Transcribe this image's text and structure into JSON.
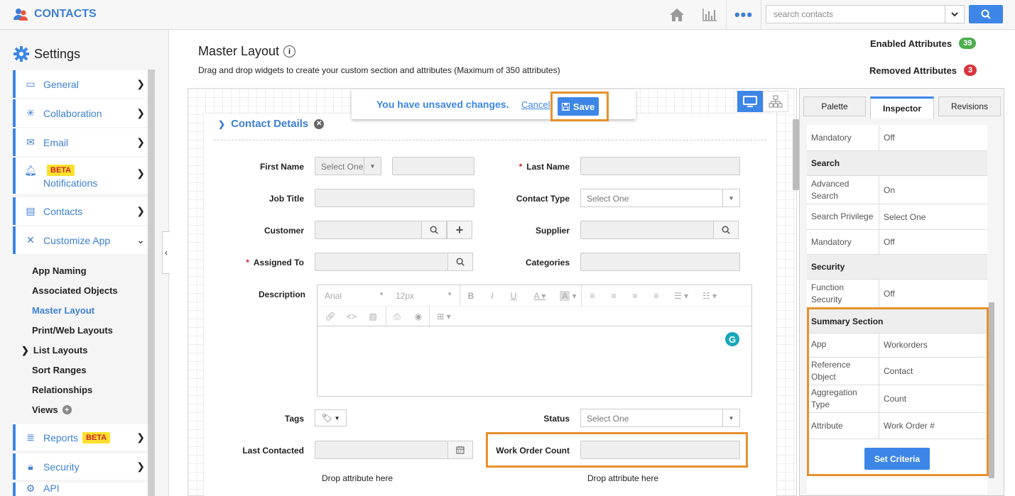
{
  "app": {
    "title": "CONTACTS"
  },
  "search": {
    "placeholder": "search contacts"
  },
  "sidebar": {
    "title": "Settings",
    "items": [
      {
        "label": "General"
      },
      {
        "label": "Collaboration"
      },
      {
        "label": "Email"
      },
      {
        "label": "Notifications",
        "badge": "BETA"
      },
      {
        "label": "Contacts"
      },
      {
        "label": "Customize App"
      },
      {
        "label": "Reports",
        "badge": "BETA"
      },
      {
        "label": "Security"
      },
      {
        "label": "API"
      }
    ],
    "sub_items": [
      "App Naming",
      "Associated Objects",
      "Master Layout",
      "Print/Web Layouts",
      "List Layouts",
      "Sort Ranges",
      "Relationships",
      "Views"
    ]
  },
  "page": {
    "title": "Master Layout",
    "description": "Drag and drop widgets to create your custom section and attributes (Maximum of 350 attributes)",
    "enabled_label": "Enabled Attributes",
    "enabled_count": "39",
    "removed_label": "Removed Attributes",
    "removed_count": "3"
  },
  "unsaved": {
    "message": "You have unsaved changes.",
    "cancel": "Cancel",
    "save": "Save"
  },
  "form": {
    "section_title": "Contact Details",
    "first_name": "First Name",
    "last_name": "Last Name",
    "job_title": "Job Title",
    "contact_type": "Contact Type",
    "customer": "Customer",
    "supplier": "Supplier",
    "assigned_to": "Assigned To",
    "categories": "Categories",
    "description": "Description",
    "tags": "Tags",
    "status": "Status",
    "last_contacted": "Last Contacted",
    "work_order_count": "Work Order Count",
    "select_one": "Select One",
    "drop_here": "Drop attribute here",
    "editor_font": "Arial",
    "editor_size": "12px"
  },
  "panel": {
    "tabs": [
      "Palette",
      "Inspector",
      "Revisions"
    ],
    "rows": {
      "mandatory1_k": "Mandatory",
      "mandatory1_v": "Off",
      "search_head": "Search",
      "adv_search_k": "Advanced Search",
      "adv_search_v": "On",
      "search_priv_k": "Search Privilege",
      "search_priv_v": "Select One",
      "mandatory2_k": "Mandatory",
      "mandatory2_v": "Off",
      "security_head": "Security",
      "func_sec_k": "Function Security",
      "func_sec_v": "Off",
      "summary_head": "Summary Section",
      "app_k": "App",
      "app_v": "Workorders",
      "ref_k": "Reference Object",
      "ref_v": "Contact",
      "agg_k": "Aggregation Type",
      "agg_v": "Count",
      "attr_k": "Attribute",
      "attr_v": "Work Order #"
    },
    "set_criteria": "Set Criteria"
  },
  "colors": {
    "accent": "#3d86e8",
    "highlight": "#e8902d",
    "beta_bg": "#fbe02e",
    "enabled_badge": "#4cae4c",
    "removed_badge": "#d9363e"
  }
}
